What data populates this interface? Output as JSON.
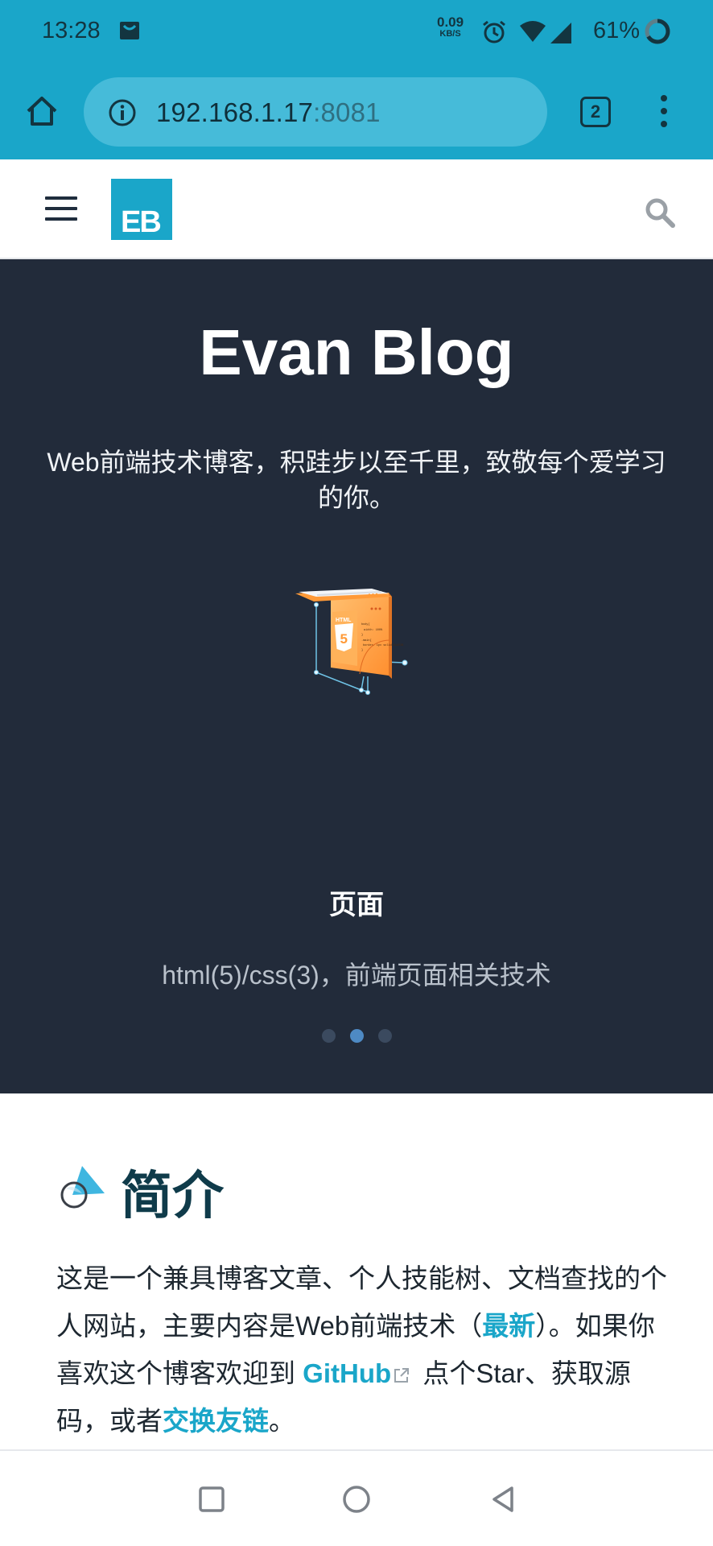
{
  "status": {
    "time": "13:28",
    "net_speed": "0.09",
    "net_unit": "KB/S",
    "battery": "61%"
  },
  "browser": {
    "url_host": "192.168.1.17",
    "url_port": ":8081",
    "tab_count": "2"
  },
  "site": {
    "logo_text": "EB"
  },
  "hero": {
    "title": "Evan Blog",
    "tagline": "Web前端技术博客，积跬步以至千里，致敬每个爱学习的你。",
    "feature_title": "页面",
    "feature_desc": "html(5)/css(3)，前端页面相关技术",
    "slides": 3,
    "active_slide": 2
  },
  "illustration": {
    "html_label": "HTML",
    "html_number": "5",
    "code_lines": [
      "body{",
      "width: 100%",
      "}",
      ".main{",
      "border: 1px solid #14f28",
      "}"
    ]
  },
  "intro": {
    "heading": "简介",
    "text_1": "这是一个兼具博客文章、个人技能树、文档查找的个人网站，主要内容是Web前端技术（",
    "link_latest": "最新",
    "text_2": "）。如果你喜欢这个博客欢迎到 ",
    "link_github": "GitHub",
    "text_3": " 点个Star、获取源码，或者",
    "link_friends": "交换友链",
    "text_4": "。"
  },
  "colors": {
    "accent": "#1aa6c9",
    "hero_bg": "#222b3a",
    "heading": "#0f3b4a"
  }
}
